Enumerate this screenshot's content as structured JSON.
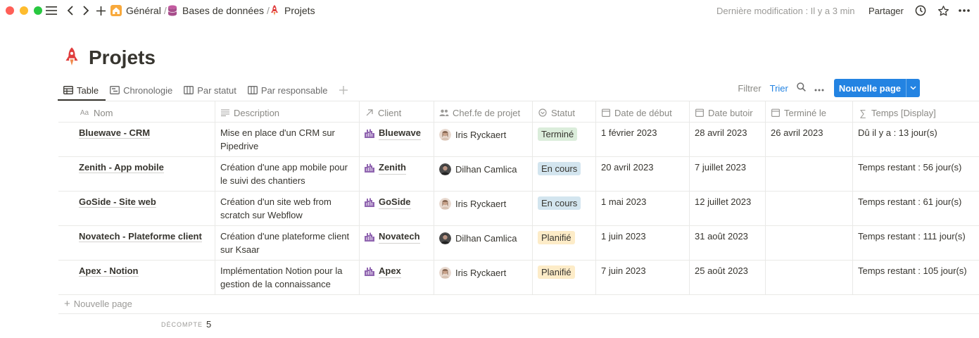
{
  "window": {
    "traffic": {
      "close": "#ff5f57",
      "minimize": "#febc2e",
      "maximize": "#28c840"
    }
  },
  "topbar": {
    "breadcrumbs": [
      {
        "label": "Général",
        "sep": "/",
        "icon": "home-icon"
      },
      {
        "label": "Bases de données",
        "sep": "/",
        "icon": "database-icon"
      },
      {
        "label": "Projets",
        "sep": "",
        "icon": "rocket-icon"
      }
    ],
    "last_edit": "Dernière modification : Il y a 3 min",
    "share": "Partager"
  },
  "page": {
    "title": "Projets",
    "icon": "rocket-icon"
  },
  "views": {
    "tabs": [
      {
        "label": "Table",
        "icon": "table-icon"
      },
      {
        "label": "Chronologie",
        "icon": "timeline-icon"
      },
      {
        "label": "Par statut",
        "icon": "board-icon"
      },
      {
        "label": "Par responsable",
        "icon": "board-icon"
      }
    ],
    "active": "Table"
  },
  "toolbar": {
    "filter": "Filtrer",
    "sort": "Trier",
    "new_page": "Nouvelle page"
  },
  "table": {
    "columns": [
      {
        "label": "Nom",
        "icon": "text-icon"
      },
      {
        "label": "Description",
        "icon": "lines-icon"
      },
      {
        "label": "Client",
        "icon": "relation-icon"
      },
      {
        "label": "Chef.fe de projet",
        "icon": "people-icon"
      },
      {
        "label": "Statut",
        "icon": "status-icon"
      },
      {
        "label": "Date de début",
        "icon": "calendar-icon"
      },
      {
        "label": "Date butoir",
        "icon": "calendar-icon"
      },
      {
        "label": "Terminé le",
        "icon": "calendar-icon"
      },
      {
        "label": "Temps [Display]",
        "icon": "formula-icon"
      }
    ],
    "rows": [
      {
        "name": "Bluewave - CRM",
        "desc1": "Mise en place d'un CRM sur",
        "desc2": "Pipedrive",
        "client": "Bluewave",
        "manager": "Iris Ryckaert",
        "status": "Terminé",
        "start": "1 février 2023",
        "due": "28 avril 2023",
        "done": "26 avril 2023",
        "time": "Dû il y a : 13 jour(s)"
      },
      {
        "name": "Zenith - App mobile",
        "desc1": "Création d'une app mobile pour",
        "desc2": "le suivi des chantiers",
        "client": "Zenith",
        "manager": "Dilhan Camlica",
        "status": "En cours",
        "start": "20 avril 2023",
        "due": "7 juillet 2023",
        "done": "",
        "time": "Temps restant : 56 jour(s)"
      },
      {
        "name": "GoSide - Site web",
        "desc1": "Création d'un site web from",
        "desc2": "scratch sur Webflow",
        "client": "GoSide",
        "manager": "Iris Ryckaert",
        "status": "En cours",
        "start": "1 mai 2023",
        "due": "12 juillet 2023",
        "done": "",
        "time": "Temps restant : 61 jour(s)"
      },
      {
        "name": "Novatech - Plateforme client",
        "desc1": "Création d'une plateforme client",
        "desc2": "sur Ksaar",
        "client": "Novatech",
        "manager": "Dilhan Camlica",
        "status": "Planifié",
        "start": "1 juin 2023",
        "due": "31 août 2023",
        "done": "",
        "time": "Temps restant : 111 jour(s)"
      },
      {
        "name": "Apex - Notion",
        "desc1": "Implémentation Notion pour la",
        "desc2": "gestion de la connaissance",
        "client": "Apex",
        "manager": "Iris Ryckaert",
        "status": "Planifié",
        "start": "7 juin 2023",
        "due": "25 août 2023",
        "done": "",
        "time": "Temps restant : 105 jour(s)"
      }
    ],
    "add_row": "Nouvelle page",
    "count_label": "DÉCOMPTE",
    "count_value": "5"
  },
  "colors": {
    "accent": "#2383e2",
    "status_termine_bg": "#dbeddb",
    "status_encours_bg": "#d3e5ef",
    "status_planifie_bg": "#fdecc8",
    "client_icon": "#9065b0",
    "rocket": "#e03e3e"
  }
}
